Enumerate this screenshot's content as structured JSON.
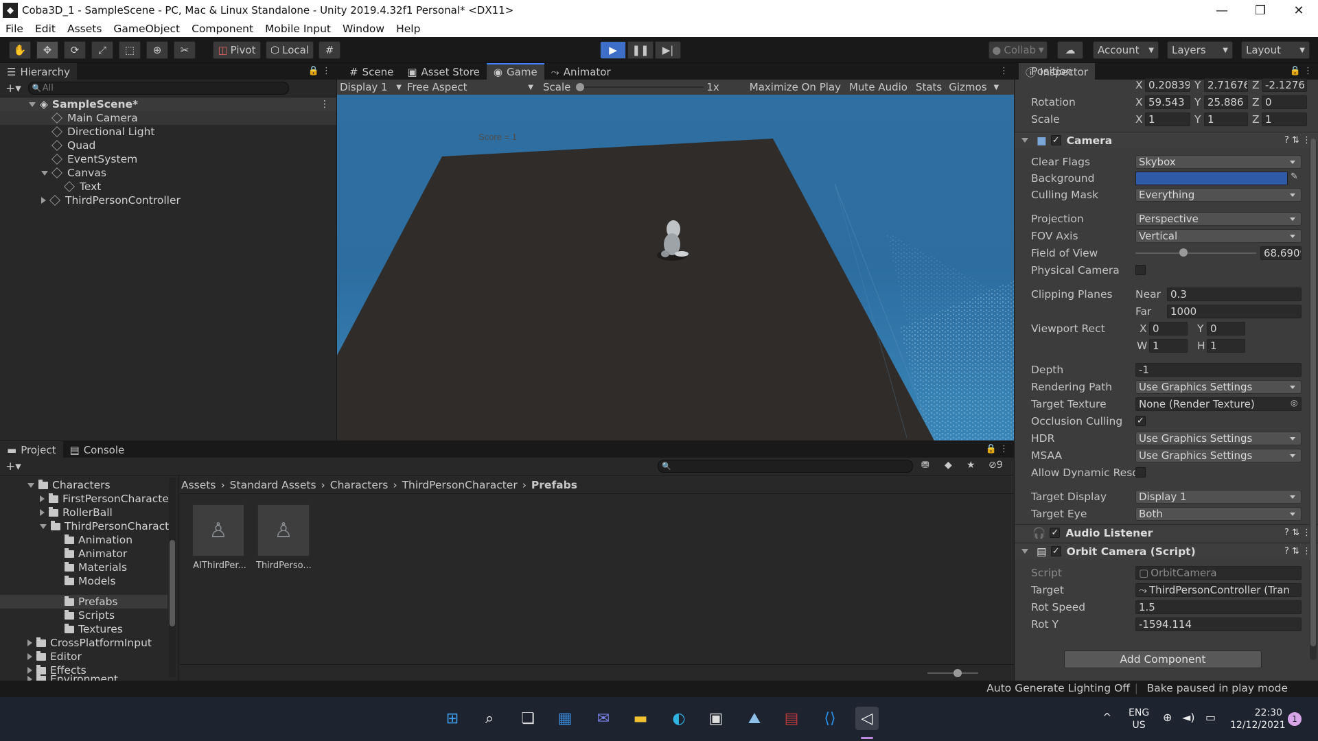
{
  "window": {
    "title": "Coba3D_1 - SampleScene - PC, Mac & Linux Standalone - Unity 2019.4.32f1 Personal* <DX11>"
  },
  "menu": [
    "File",
    "Edit",
    "Assets",
    "GameObject",
    "Component",
    "Mobile Input",
    "Window",
    "Help"
  ],
  "toolbar": {
    "pivot": "Pivot",
    "local": "Local",
    "collab": "Collab",
    "account": "Account",
    "layers": "Layers",
    "layout": "Layout"
  },
  "hierarchy": {
    "tab": "Hierarchy",
    "search_placeholder": "All",
    "scene": "SampleScene*",
    "items": [
      "Main Camera",
      "Directional Light",
      "Quad",
      "EventSystem",
      "Canvas",
      "Text",
      "ThirdPersonController"
    ]
  },
  "game": {
    "tabs": [
      "Scene",
      "Asset Store",
      "Game",
      "Animator"
    ],
    "display": "Display 1",
    "aspect": "Free Aspect",
    "scale_label": "Scale",
    "scale_value": "1x",
    "buttons": [
      "Maximize On Play",
      "Mute Audio",
      "Stats",
      "Gizmos"
    ],
    "score_text": "Score = 1"
  },
  "inspector": {
    "tab": "Inspector",
    "transform": {
      "position_label": "Position",
      "rotation_label": "Rotation",
      "scale_label": "Scale",
      "position": {
        "x": "0.20839",
        "y": "2.71676",
        "z": "-2.1276"
      },
      "rotation": {
        "x": "59.543",
        "y": "25.886",
        "z": "0"
      },
      "scale": {
        "x": "1",
        "y": "1",
        "z": "1"
      }
    },
    "camera": {
      "title": "Camera",
      "clear_flags_label": "Clear Flags",
      "clear_flags": "Skybox",
      "background_label": "Background",
      "background_color": "#2e5aa8",
      "culling_mask_label": "Culling Mask",
      "culling_mask": "Everything",
      "projection_label": "Projection",
      "projection": "Perspective",
      "fov_axis_label": "FOV Axis",
      "fov_axis": "Vertical",
      "fov_label": "Field of View",
      "fov": "68.6909",
      "physical_label": "Physical Camera",
      "clipping_label": "Clipping Planes",
      "near_label": "Near",
      "near": "0.3",
      "far_label": "Far",
      "far": "1000",
      "viewport_label": "Viewport Rect",
      "vx": "0",
      "vy": "0",
      "vw": "1",
      "vh": "1",
      "depth_label": "Depth",
      "depth": "-1",
      "rendering_path_label": "Rendering Path",
      "rendering_path": "Use Graphics Settings",
      "target_texture_label": "Target Texture",
      "target_texture": "None (Render Texture)",
      "occlusion_label": "Occlusion Culling",
      "hdr_label": "HDR",
      "hdr": "Use Graphics Settings",
      "msaa_label": "MSAA",
      "msaa": "Use Graphics Settings",
      "dynres_label": "Allow Dynamic Reso",
      "target_display_label": "Target Display",
      "target_display": "Display 1",
      "target_eye_label": "Target Eye",
      "target_eye": "Both"
    },
    "audio_listener": "Audio Listener",
    "orbit": {
      "title": "Orbit Camera (Script)",
      "script_label": "Script",
      "script": "OrbitCamera",
      "target_label": "Target",
      "target": "ThirdPersonController (Tran",
      "rot_speed_label": "Rot Speed",
      "rot_speed": "1.5",
      "rot_y_label": "Rot Y",
      "rot_y": "-1594.114"
    },
    "add_component": "Add Component"
  },
  "project": {
    "tabs": [
      "Project",
      "Console"
    ],
    "hidden_count": "9",
    "tree": [
      "Characters",
      "FirstPersonCharacte",
      "RollerBall",
      "ThirdPersonCharact",
      "Animation",
      "Animator",
      "Materials",
      "Models",
      "Prefabs",
      "Scripts",
      "Textures",
      "CrossPlatformInput",
      "Editor",
      "Effects",
      "Environment"
    ],
    "breadcrumb": [
      "Assets",
      "Standard Assets",
      "Characters",
      "ThirdPersonCharacter",
      "Prefabs"
    ],
    "assets": [
      "AIThirdPer...",
      "ThirdPerso..."
    ]
  },
  "status": {
    "lighting": "Auto Generate Lighting Off",
    "bake": "Bake paused in play mode"
  },
  "taskbar": {
    "lang": "ENG",
    "region": "US",
    "time": "22:30",
    "date": "12/12/2021",
    "notif": "1"
  }
}
